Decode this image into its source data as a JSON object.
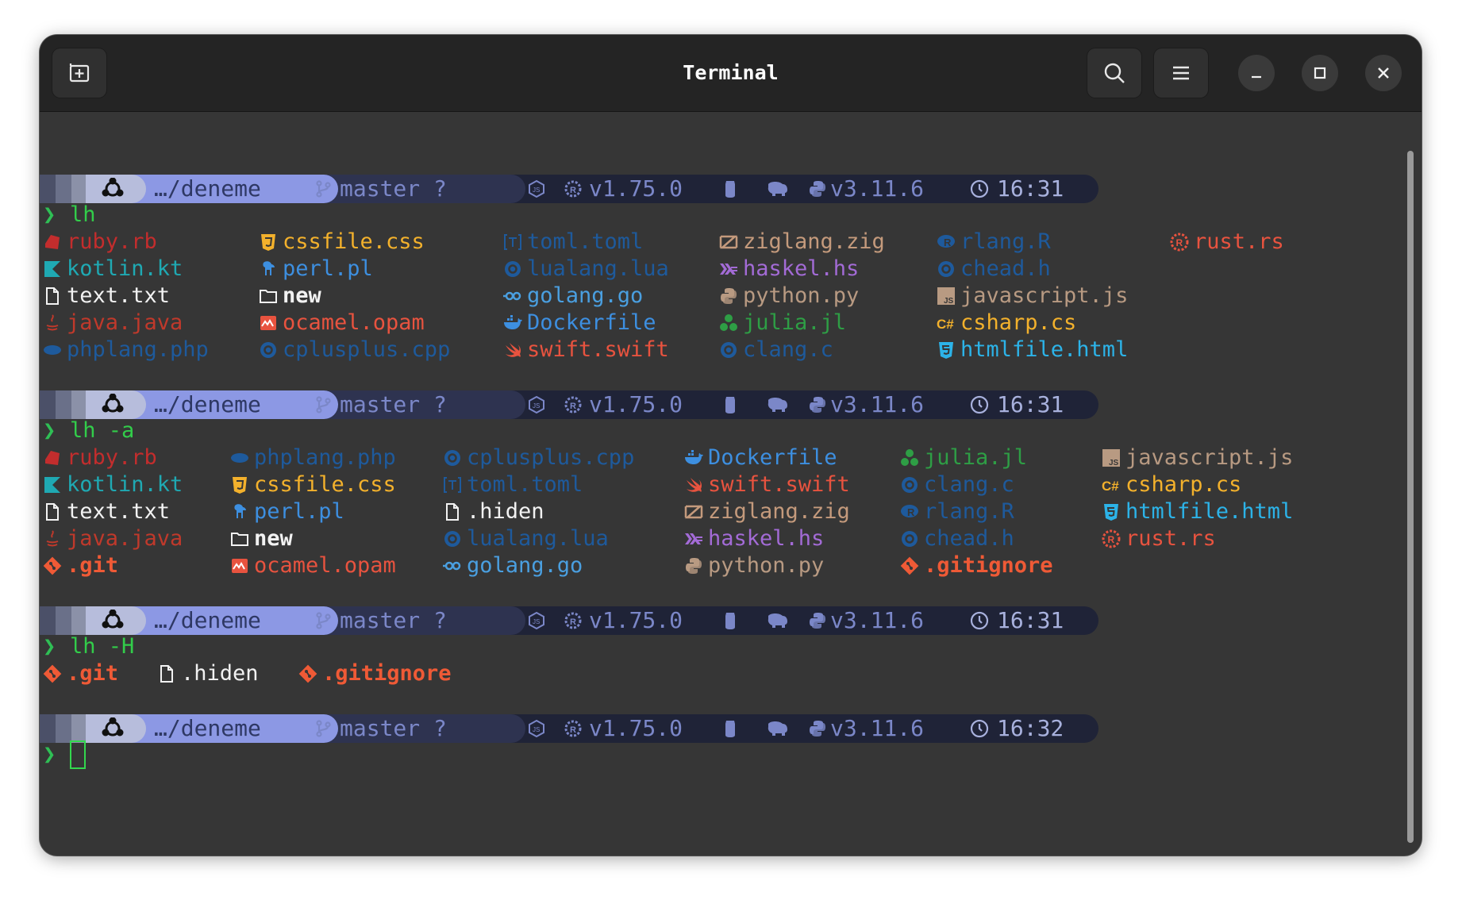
{
  "window": {
    "title": "Terminal"
  },
  "colors": {
    "ruby": "#c32d2d",
    "kotlin": "#1fa9b3",
    "text": "#f2f2f2",
    "java": "#c0392b",
    "php": "#1e5a9c",
    "css": "#f3b12c",
    "perl": "#3d8fe0",
    "new": "#f2f2f2",
    "ocaml": "#e8533f",
    "cpp": "#1e5a9c",
    "toml": "#1e5a9c",
    "lua": "#1e5a9c",
    "golang": "#4a9fe0",
    "docker": "#3d8fe0",
    "swift": "#e8533f",
    "zig": "#c49a7c",
    "haskell": "#a36bd6",
    "python": "#b89a82",
    "julia": "#2e9e45",
    "clang": "#1e5a9c",
    "r": "#1e5a9c",
    "chead": "#1e5a9c",
    "javascript": "#b89a82",
    "csharp": "#f3b12c",
    "html": "#2cb3e8",
    "rust": "#e8533f",
    "git": "#ef5a36",
    "hiden": "#f2f2f2"
  },
  "prompt": {
    "path": "…/deneme",
    "git": "master ?",
    "rust_version": "v1.75.0",
    "python_version": "v3.11.6"
  },
  "prompts": [
    {
      "time": "16:31",
      "command": "lh"
    },
    {
      "time": "16:31",
      "command": "lh -a"
    },
    {
      "time": "16:31",
      "command": "lh -H"
    },
    {
      "time": "16:32",
      "command": ""
    }
  ],
  "chevron": "❯",
  "listing1": [
    [
      "ruby.rb",
      "kotlin.kt",
      "text.txt",
      "java.java",
      "phplang.php"
    ],
    [
      "cssfile.css",
      "perl.pl",
      "new",
      "ocamel.opam",
      "cplusplus.cpp"
    ],
    [
      "toml.toml",
      "lualang.lua",
      "golang.go",
      "Dockerfile",
      "swift.swift"
    ],
    [
      "ziglang.zig",
      "haskel.hs",
      "python.py",
      "julia.jl",
      "clang.c"
    ],
    [
      "rlang.R",
      "chead.h",
      "javascript.js",
      "csharp.cs",
      "htmlfile.html"
    ],
    [
      "rust.rs"
    ]
  ],
  "listing2": [
    [
      "ruby.rb",
      "kotlin.kt",
      "text.txt",
      "java.java",
      ".git"
    ],
    [
      "phplang.php",
      "cssfile.css",
      "perl.pl",
      "new",
      "ocamel.opam"
    ],
    [
      "cplusplus.cpp",
      "toml.toml",
      ".hiden",
      "lualang.lua",
      "golang.go"
    ],
    [
      "Dockerfile",
      "swift.swift",
      "ziglang.zig",
      "haskel.hs",
      "python.py"
    ],
    [
      "julia.jl",
      "clang.c",
      "rlang.R",
      "chead.h",
      ".gitignore"
    ],
    [
      "javascript.js",
      "csharp.cs",
      "htmlfile.html",
      "rust.rs"
    ]
  ],
  "listing3": [
    ".git",
    ".hiden",
    ".gitignore"
  ]
}
